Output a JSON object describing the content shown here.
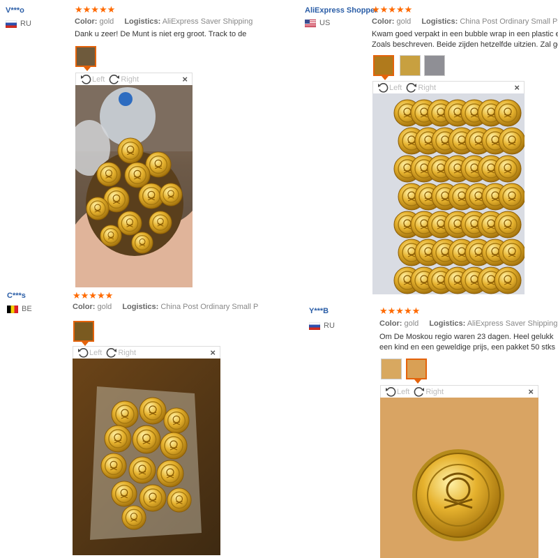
{
  "reviews": [
    {
      "user": "V***o",
      "country": "RU",
      "color_label": "Color:",
      "color_value": "gold",
      "logistics_label": "Logistics:",
      "logistics_value": "AliExpress Saver Shipping",
      "text_lines": [
        "Dank u zeer! De Munt is niet erg groot. Track to de"
      ],
      "left_label": "Left",
      "right_label": "Right",
      "close": "×",
      "stars": "★★★★★"
    },
    {
      "user": "AliExpress Shopper",
      "country": "US",
      "color_label": "Color:",
      "color_value": "gold",
      "logistics_label": "Logistics:",
      "logistics_value": "China Post Ordinary Small Packe",
      "text_lines": [
        "Kwam goed verpakt in een bubble wrap in een plastic e",
        "Zoals beschreven. Beide zijden hetzelfde uitzien. Zal ge"
      ],
      "left_label": "Left",
      "right_label": "Right",
      "close": "×",
      "stars": "★★★★★"
    },
    {
      "user": "C***s",
      "country": "BE",
      "color_label": "Color:",
      "color_value": "gold",
      "logistics_label": "Logistics:",
      "logistics_value": "China Post Ordinary Small P",
      "text_lines": [],
      "left_label": "Left",
      "right_label": "Right",
      "close": "×",
      "stars": "★★★★★"
    },
    {
      "user": "Y***B",
      "country": "RU",
      "color_label": "Color:",
      "color_value": "gold",
      "logistics_label": "Logistics:",
      "logistics_value": "AliExpress Saver Shipping",
      "text_lines": [
        "Om De Moskou regio waren 23 dagen. Heel gelukk",
        "een kind en een geweldige prijs, een pakket 50 stks"
      ],
      "left_label": "Left",
      "right_label": "Right",
      "close": "×",
      "stars": "★★★★★"
    }
  ],
  "colors": {
    "accent": "#e4630b",
    "star": "#ff6a00",
    "username": "#2b5ea7",
    "gold": "#d4a72c"
  }
}
